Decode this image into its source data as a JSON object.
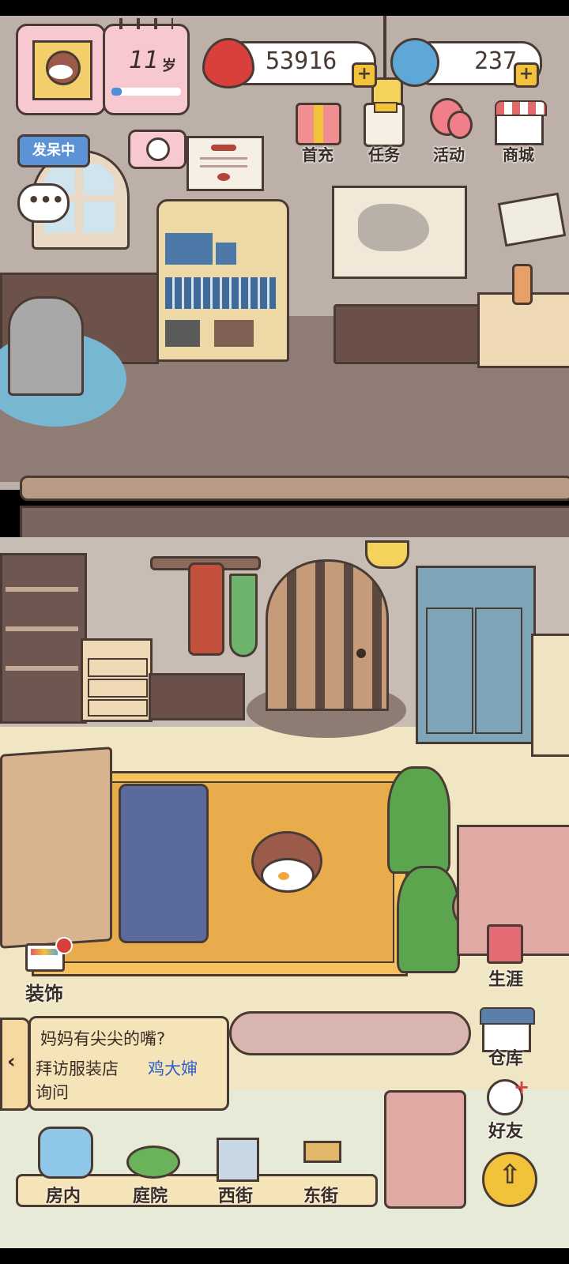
{
  "profile": {
    "age_number": "11",
    "age_unit": "岁",
    "status_tag": "发呆中",
    "age_progress": 0.15
  },
  "currency": {
    "hearts": "53916",
    "gems": "237"
  },
  "top_menu": [
    {
      "label": "首充",
      "icon": "gift-icon"
    },
    {
      "label": "任务",
      "icon": "clipboard-icon"
    },
    {
      "label": "活动",
      "icon": "balloon-icon"
    },
    {
      "label": "商城",
      "icon": "shop-icon"
    }
  ],
  "right_menu": [
    {
      "label": "生涯",
      "icon": "book-icon"
    },
    {
      "label": "仓库",
      "icon": "warehouse-icon"
    },
    {
      "label": "好友",
      "icon": "friends-icon"
    }
  ],
  "decorate": {
    "label": "装饰",
    "icon": "paint-roller-icon"
  },
  "quest": {
    "title": "妈妈有尖尖的嘴?",
    "line1_prefix": "拜访服装店",
    "line1_highlight": "鸡大婶",
    "line2": "询问"
  },
  "bottom_nav": [
    {
      "label": "房内",
      "icon": "bed-icon"
    },
    {
      "label": "庭院",
      "icon": "garden-icon"
    },
    {
      "label": "西街",
      "icon": "building-icon"
    },
    {
      "label": "东街",
      "icon": "signpost-icon"
    }
  ],
  "colors": {
    "outline": "#4a3a34",
    "pink": "#f7c8cf",
    "gold": "#f2c23a",
    "quest_highlight": "#2a62c9"
  }
}
